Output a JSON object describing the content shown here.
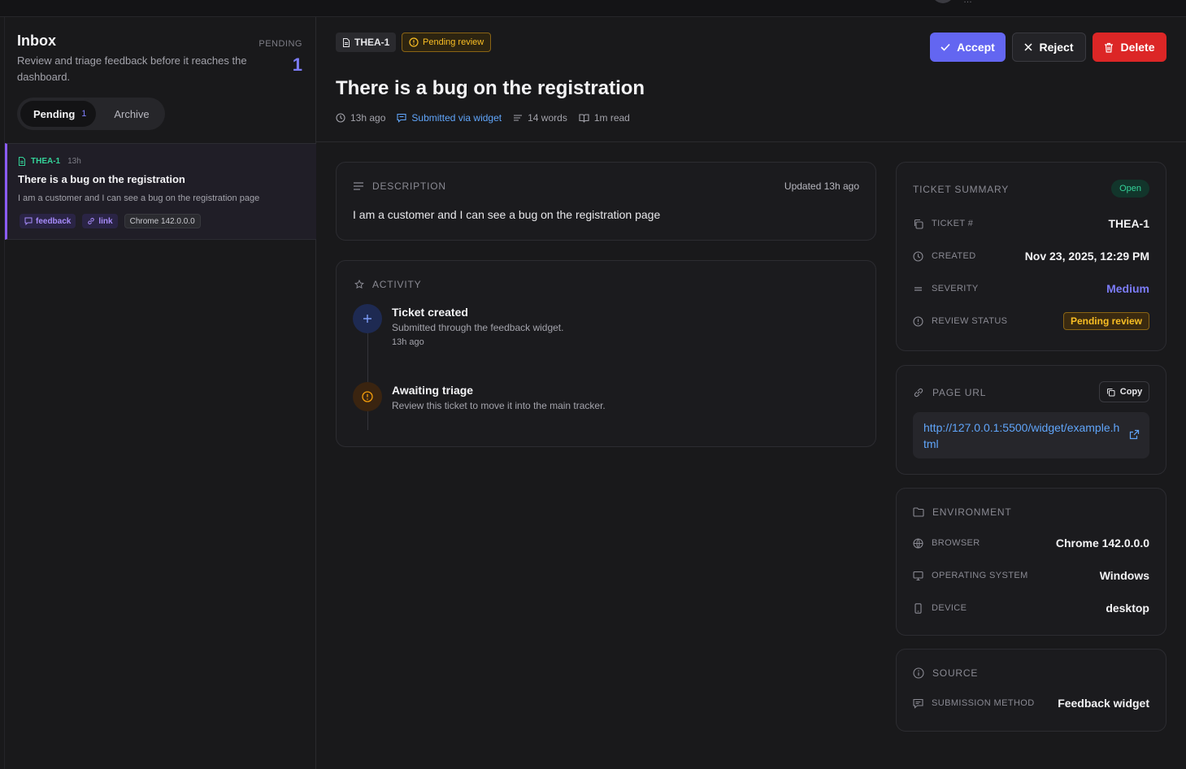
{
  "topbar": {
    "user_label": "…"
  },
  "sidebar": {
    "title": "Inbox",
    "subtitle": "Review and triage feedback before it reaches the dashboard.",
    "pending_label": "PENDING",
    "pending_count": "1",
    "tabs": [
      {
        "label": "Pending",
        "count": "1",
        "active": true
      },
      {
        "label": "Archive",
        "active": false
      }
    ],
    "items": [
      {
        "id": "THEA-1",
        "time": "13h",
        "title": "There is a bug on the registration",
        "description": "I am a customer and I can see a bug on the registration page",
        "tags": [
          "feedback",
          "link",
          "Chrome 142.0.0.0"
        ]
      }
    ]
  },
  "ticket": {
    "id": "THEA-1",
    "status": "Pending review",
    "title": "There is a bug on the registration",
    "meta": {
      "age": "13h ago",
      "source": "Submitted via widget",
      "words": "14 words",
      "read": "1m read"
    }
  },
  "actions": {
    "accept": "Accept",
    "reject": "Reject",
    "delete": "Delete"
  },
  "description": {
    "heading": "DESCRIPTION",
    "updated": "Updated 13h ago",
    "text": "I am a customer and I can see a bug on the registration page"
  },
  "activity": {
    "heading": "ACTIVITY",
    "events": [
      {
        "title": "Ticket created",
        "subtitle": "Submitted through the feedback widget.",
        "time": "13h ago"
      },
      {
        "title": "Awaiting triage",
        "subtitle": "Review this ticket to move it into the main tracker."
      }
    ]
  },
  "summary": {
    "heading": "TICKET SUMMARY",
    "badge": "Open",
    "rows": [
      {
        "label": "TICKET #",
        "value": "THEA-1"
      },
      {
        "label": "CREATED",
        "value": "Nov 23, 2025, 12:29 PM"
      },
      {
        "label": "SEVERITY",
        "value": "Medium"
      },
      {
        "label": "REVIEW STATUS",
        "value": "Pending review"
      }
    ]
  },
  "page_url": {
    "heading": "PAGE URL",
    "copy_label": "Copy",
    "url": "http://127.0.0.1:5500/widget/example.html"
  },
  "environment": {
    "heading": "ENVIRONMENT",
    "rows": [
      {
        "label": "BROWSER",
        "value": "Chrome 142.0.0.0"
      },
      {
        "label": "OPERATING SYSTEM",
        "value": "Windows"
      },
      {
        "label": "DEVICE",
        "value": "desktop"
      }
    ]
  },
  "source": {
    "heading": "SOURCE",
    "rows": [
      {
        "label": "SUBMISSION METHOD",
        "value": "Feedback widget"
      }
    ]
  },
  "colors": {
    "accent": "#6366f1",
    "danger": "#dc2626",
    "warning": "#fbbf24",
    "success": "#34d399",
    "link": "#60a5fa",
    "highlight": "#8a5cf6"
  }
}
